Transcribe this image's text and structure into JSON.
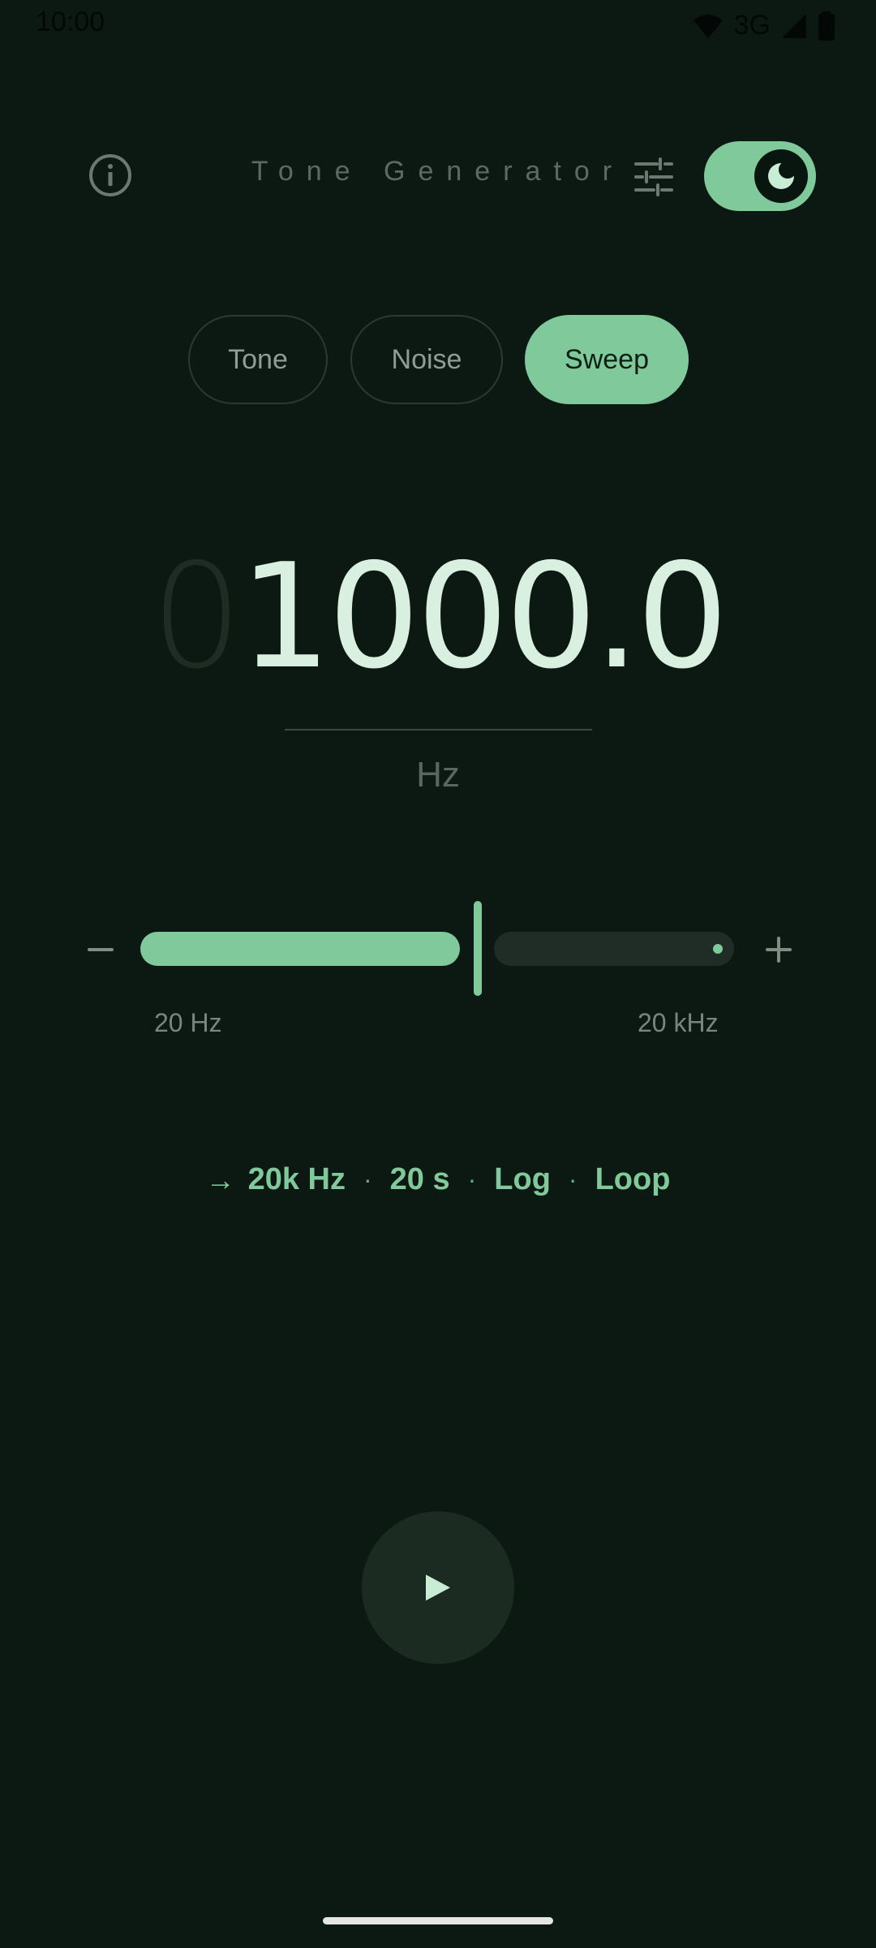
{
  "status_bar": {
    "time": "10:00",
    "network": "3G"
  },
  "header": {
    "title": "Tone Generator"
  },
  "modes": {
    "tabs": [
      {
        "label": "Tone",
        "selected": false
      },
      {
        "label": "Noise",
        "selected": false
      },
      {
        "label": "Sweep",
        "selected": true
      }
    ]
  },
  "frequency": {
    "leading_digit": "0",
    "value": "1000.0",
    "unit": "Hz"
  },
  "slider": {
    "min_label": "20 Hz",
    "max_label": "20 kHz",
    "position_fraction": 0.55
  },
  "sweep": {
    "arrow": "→",
    "target": "20k Hz",
    "duration": "20 s",
    "scale": "Log",
    "mode": "Loop",
    "separator": "·"
  },
  "colors": {
    "background": "#0c1913",
    "accent": "#80c99b",
    "text_primary": "#d9efe0",
    "text_muted": "#5b6b62"
  },
  "icons": {
    "info": "info-icon",
    "tune": "tune-icon",
    "theme": "moon-icon",
    "play": "play-icon",
    "minus": "minus-icon",
    "plus": "plus-icon"
  }
}
